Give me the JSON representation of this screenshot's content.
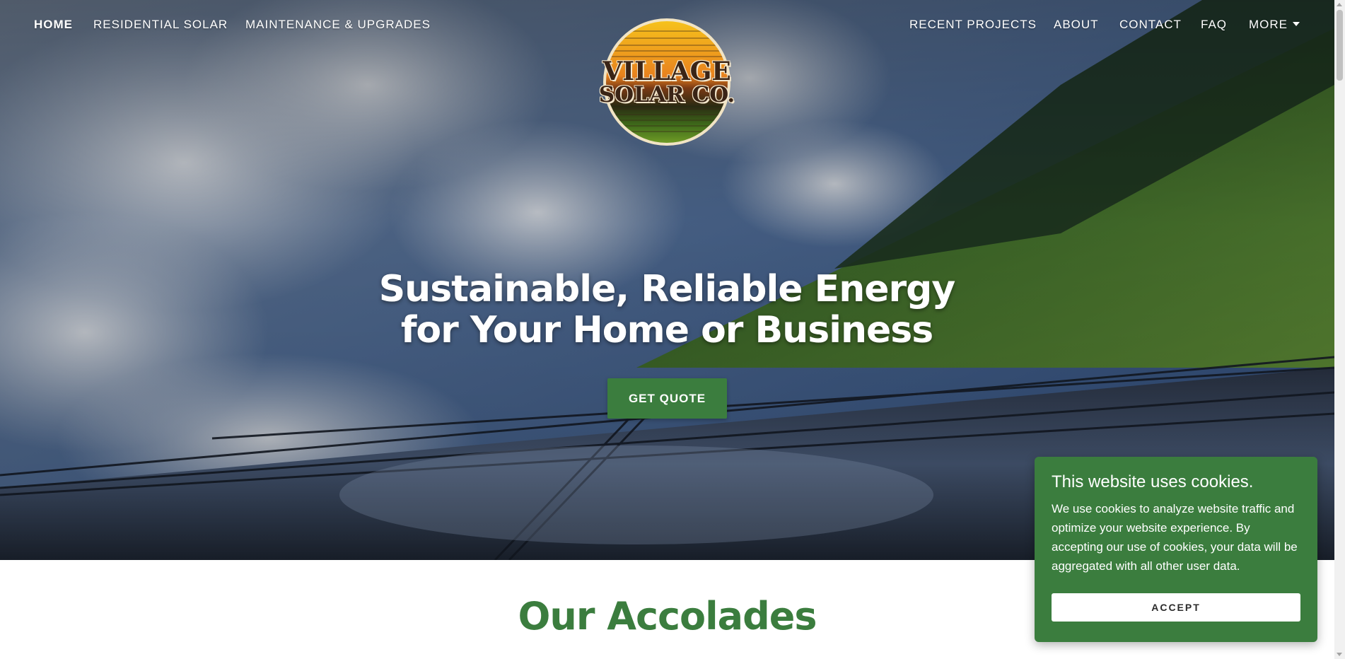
{
  "nav": {
    "left": [
      {
        "label": "HOME",
        "active": true
      },
      {
        "label": "RESIDENTIAL SOLAR",
        "active": false
      },
      {
        "label": "MAINTENANCE & UPGRADES",
        "active": false
      }
    ],
    "right": [
      {
        "label": "RECENT PROJECTS"
      },
      {
        "label": "ABOUT"
      },
      {
        "label": "CONTACT"
      },
      {
        "label": "FAQ"
      },
      {
        "label": "MORE",
        "icon": "chevron-down-icon"
      }
    ]
  },
  "logo": {
    "line1": "VILLAGE",
    "line2": "SOLAR CO."
  },
  "hero": {
    "headline_line1": "Sustainable, Reliable Energy",
    "headline_line2": "for Your Home or Business",
    "cta_label": "GET QUOTE"
  },
  "section": {
    "title": "Our Accolades"
  },
  "cookie": {
    "title": "This website uses cookies.",
    "body": "We use cookies to analyze website traffic and optimize your website experience. By accepting our use of cookies, your data will be aggregated with all other user data.",
    "accept_label": "ACCEPT"
  },
  "colors": {
    "brand_green": "#3b7d3e",
    "nav_text": "#ffffff",
    "logo_orange": "#f0a21c",
    "logo_green": "#4b7a1c"
  }
}
